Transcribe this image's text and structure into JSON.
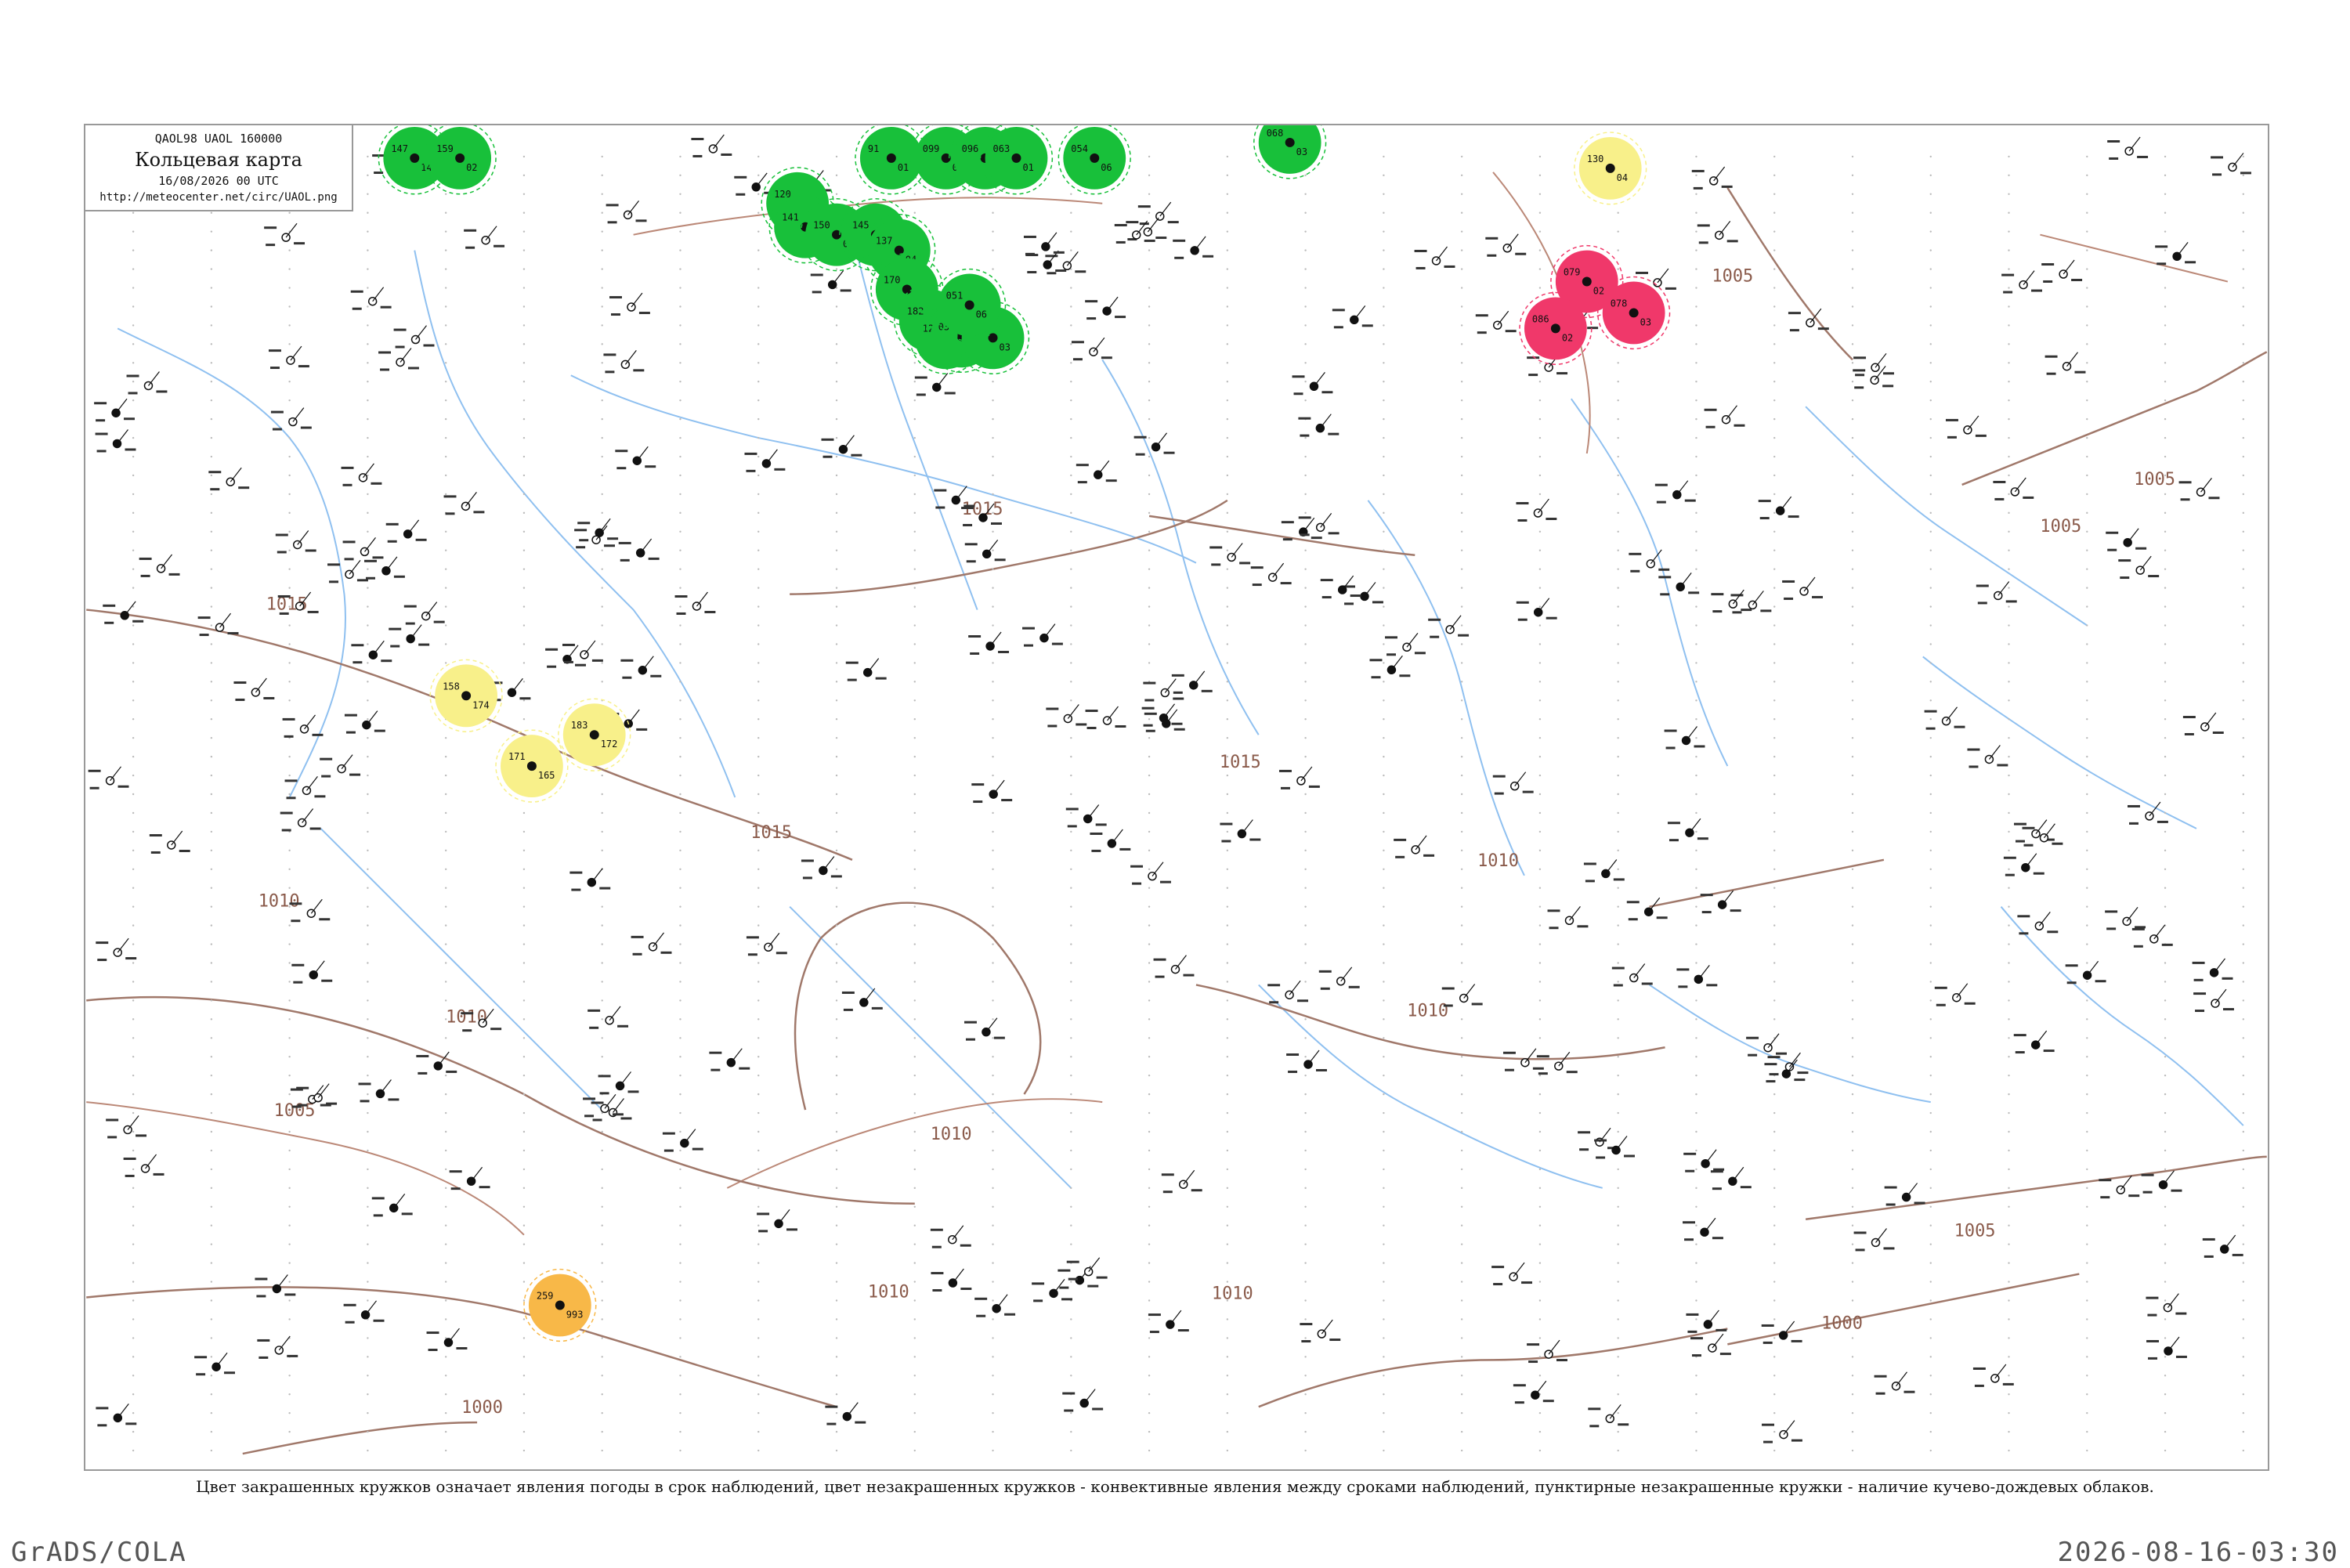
{
  "legend": {
    "code": "QAOL98 UAOL 160000",
    "title": "Кольцевая карта",
    "datetime": "16/08/2026 00 UTC",
    "url": "http://meteocenter.net/circ/UAOL.png"
  },
  "caption": "Цвет закрашенных кружков означает явления погоды в срок наблюдений, цвет незакрашенных кружков - конвективные явления между сроками наблюдений, пунктирные незакрашенные кружки - наличие кучево-дождевых облаков.",
  "footer": {
    "left": "GrADS/COLA",
    "right": "2026-08-16-03:30"
  },
  "colors": {
    "isobar": "#a0786a",
    "river": "#8fc0f0",
    "rain": "#18c03a",
    "fog": "#f8f08a",
    "thunder": "#f0386a",
    "dust": "#f8b848",
    "frame": "#999999"
  },
  "isobar_labels": [
    "1015",
    "1015",
    "1015",
    "1015",
    "1010",
    "1010",
    "1010",
    "1010",
    "1010",
    "1005",
    "1005",
    "1005",
    "1005",
    "1005",
    "1000",
    "1000",
    "1010",
    "1010"
  ],
  "stations": [
    {
      "type": "rain",
      "n": [
        "147",
        "149"
      ]
    },
    {
      "type": "rain",
      "n": [
        "159",
        "02"
      ]
    },
    {
      "type": "rain",
      "n": [
        "120",
        "03"
      ]
    },
    {
      "type": "rain",
      "n": [
        "91",
        "01"
      ]
    },
    {
      "type": "rain",
      "n": [
        "099",
        "02"
      ]
    },
    {
      "type": "rain",
      "n": [
        "096",
        "04"
      ]
    },
    {
      "type": "rain",
      "n": [
        "063",
        "01"
      ]
    },
    {
      "type": "rain",
      "n": [
        "054",
        "06"
      ]
    },
    {
      "type": "rain",
      "n": [
        "068",
        "03"
      ]
    },
    {
      "type": "rain",
      "n": [
        "141",
        "02"
      ]
    },
    {
      "type": "rain",
      "n": [
        "150",
        "08"
      ]
    },
    {
      "type": "rain",
      "n": [
        "145",
        "06"
      ]
    },
    {
      "type": "rain",
      "n": [
        "137",
        "04"
      ]
    },
    {
      "type": "rain",
      "n": [
        "170",
        "05"
      ]
    },
    {
      "type": "rain",
      "n": [
        "182",
        "04"
      ]
    },
    {
      "type": "rain",
      "n": [
        "120",
        "04"
      ]
    },
    {
      "type": "rain",
      "n": [
        "038",
        "09"
      ]
    },
    {
      "type": "rain",
      "n": [
        "042",
        "03"
      ]
    },
    {
      "type": "rain",
      "n": [
        "051",
        "06"
      ]
    },
    {
      "type": "fog",
      "n": [
        "158",
        "174"
      ]
    },
    {
      "type": "fog",
      "n": [
        "171",
        "165"
      ]
    },
    {
      "type": "fog",
      "n": [
        "183",
        "172"
      ]
    },
    {
      "type": "fog",
      "n": [
        "130",
        "04"
      ]
    },
    {
      "type": "thunder",
      "n": [
        "079",
        "02"
      ]
    },
    {
      "type": "thunder",
      "n": [
        "078",
        "03"
      ]
    },
    {
      "type": "thunder",
      "n": [
        "086",
        "02"
      ]
    },
    {
      "type": "dust",
      "n": [
        "259",
        "993"
      ]
    }
  ]
}
